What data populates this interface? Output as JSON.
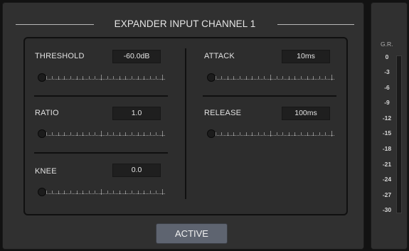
{
  "title": "EXPANDER INPUT CHANNEL 1",
  "params": {
    "threshold": {
      "label": "THRESHOLD",
      "value": "-60.0dB",
      "level": 0.0
    },
    "ratio": {
      "label": "RATIO",
      "value": "1.0",
      "level": 0.0
    },
    "knee": {
      "label": "KNEE",
      "value": "0.0",
      "level": 0.0
    },
    "attack": {
      "label": "ATTACK",
      "value": "10ms",
      "level": 0.0
    },
    "release": {
      "label": "RELEASE",
      "value": "100ms",
      "level": 0.0
    }
  },
  "active_button": {
    "label": "ACTIVE"
  },
  "gr_meter": {
    "label": "G.R.",
    "ticks": [
      "0",
      "-3",
      "-6",
      "-9",
      "-12",
      "-15",
      "-18",
      "-21",
      "-24",
      "-27",
      "-30"
    ],
    "level": 0.0
  },
  "colors": {
    "panel": "#303030",
    "active_button": "#5e6470"
  }
}
